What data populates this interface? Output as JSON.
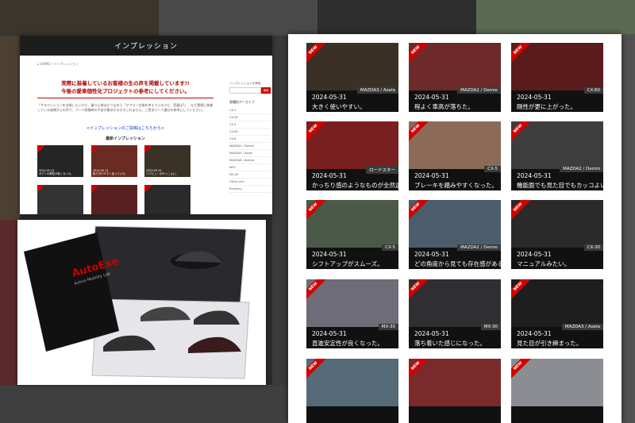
{
  "impression_page": {
    "header_title": "インプレッション",
    "breadcrumb": "⌂ HOME / インプレッション",
    "lead_line1": "実際に装着しているお客様の生の声を掲載しています!!",
    "lead_line2": "今後の愛車個性化プロジェクトの参考にしてください。",
    "description": "「サスペンションを交換したいけど、乗り心地はどうなの?」「マフラー交換を考えているけど、音量は?」…など実際に装着している皆様からの声で、パーツ装備時の不安が解決するかもしれません。ご是非パーツ選びの参考にしてください。",
    "form_link": "<インプレッションのご投稿はこちらから>",
    "latest_heading": "最新インプレッション",
    "latest_items": [
      {
        "date": "2024-05-31",
        "title": "ボディの剛性が高くなった。"
      },
      {
        "date": "2024-05-31",
        "title": "取り付けやすく走っていた。"
      },
      {
        "date": "2024-05-31",
        "title": "リアビューがかっこよい。"
      },
      {
        "date": "",
        "title": ""
      },
      {
        "date": "",
        "title": ""
      },
      {
        "date": "",
        "title": ""
      }
    ],
    "sidebar": {
      "search_label": "インプレッションを検索",
      "search_button": "検索",
      "archive_heading": "車種別アーカイブ",
      "archive_items": [
        "CX-3",
        "CX-30",
        "CX-5",
        "CX-60",
        "CX-8",
        "MAZDA2 / Demio",
        "MAZDA3 / Axela",
        "MAZDA6 / Atenza",
        "MPV",
        "MX-30",
        "Other cars",
        "Premacy"
      ]
    }
  },
  "brochure": {
    "brand": "AutoExe",
    "tagline": "Active Mobility Lab"
  },
  "grid": {
    "new_badge": "NEW",
    "cards": [
      {
        "date": "2024-05-31",
        "title": "大きく使いやすい。",
        "tag": "MAZDA3 / Axela",
        "photo": "#3a3026"
      },
      {
        "date": "2024-05-31",
        "title": "程よく車高が落ちた。",
        "tag": "MAZDA2 / Demio",
        "photo": "#6c2a2a"
      },
      {
        "date": "2024-05-31",
        "title": "剛性が更に上がった。",
        "tag": "CX-60",
        "photo": "#5a1b1b"
      },
      {
        "date": "2024-05-31",
        "title": "かっちり感のようなものが全然違う。",
        "tag": "ロードスター",
        "photo": "#7a1f1f"
      },
      {
        "date": "2024-05-31",
        "title": "ブレーキを踏みやすくなった。",
        "tag": "CX-5",
        "photo": "#8c6a58"
      },
      {
        "date": "2024-05-31",
        "title": "機能面でも見た目でもカッコよい。",
        "tag": "MAZDA2 / Demio",
        "photo": "#3d3d3d"
      },
      {
        "date": "2024-05-31",
        "title": "シフトアップがスムーズ。",
        "tag": "CX-5",
        "photo": "#4b5a48"
      },
      {
        "date": "2024-05-31",
        "title": "どの角度から見ても存在感がある。",
        "tag": "MAZDA2 / Demio",
        "photo": "#4b5c6c"
      },
      {
        "date": "2024-05-31",
        "title": "マニュアルみたい。",
        "tag": "CX-30",
        "photo": "#2a2a2a"
      },
      {
        "date": "2024-05-31",
        "title": "直進安定性が良くなった。",
        "tag": "MX-30",
        "photo": "#6d6c78"
      },
      {
        "date": "2024-05-31",
        "title": "落ち着いた感じになった。",
        "tag": "MX-30",
        "photo": "#2f2f33"
      },
      {
        "date": "2024-05-31",
        "title": "見た目が引き締まった。",
        "tag": "MAZDA3 / Axela",
        "photo": "#1e1e1e"
      },
      {
        "date": "",
        "title": "",
        "tag": "",
        "photo": "#556b7a"
      },
      {
        "date": "",
        "title": "",
        "tag": "",
        "photo": "#7a2a2a"
      },
      {
        "date": "",
        "title": "",
        "tag": "",
        "photo": "#8a8e92"
      }
    ]
  }
}
